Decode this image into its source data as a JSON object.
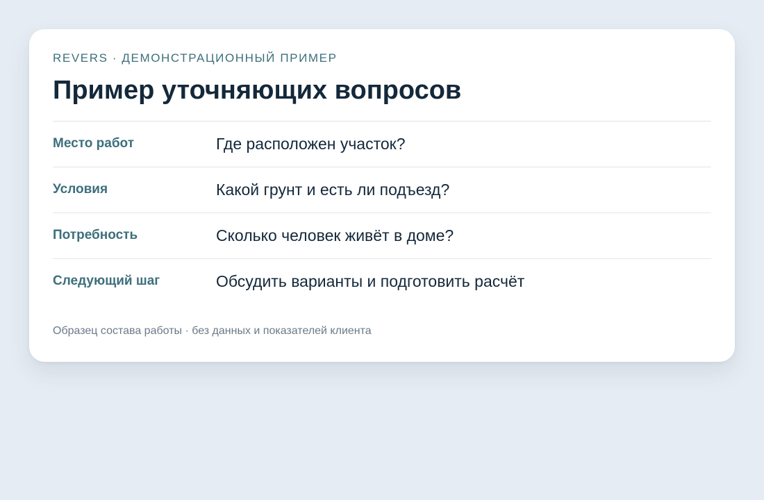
{
  "card": {
    "eyebrow": "REVERS · ДЕМОНСТРАЦИОННЫЙ ПРИМЕР",
    "title": "Пример уточняющих вопросов",
    "rows": [
      {
        "label": "Место работ",
        "value": "Где расположен участок?"
      },
      {
        "label": "Условия",
        "value": "Какой грунт и есть ли подъезд?"
      },
      {
        "label": "Потребность",
        "value": "Сколько человек живёт в доме?"
      },
      {
        "label": "Следующий шаг",
        "value": "Обсудить варианты и подготовить расчёт"
      }
    ],
    "footnote": "Образец состава работы · без данных и показателей клиента"
  },
  "colors": {
    "background": "#e6ecf3",
    "card": "#ffffff",
    "accent": "#3d6f7c",
    "text": "#14283a",
    "muted": "#6b7a88",
    "divider": "#e1e5ea"
  }
}
